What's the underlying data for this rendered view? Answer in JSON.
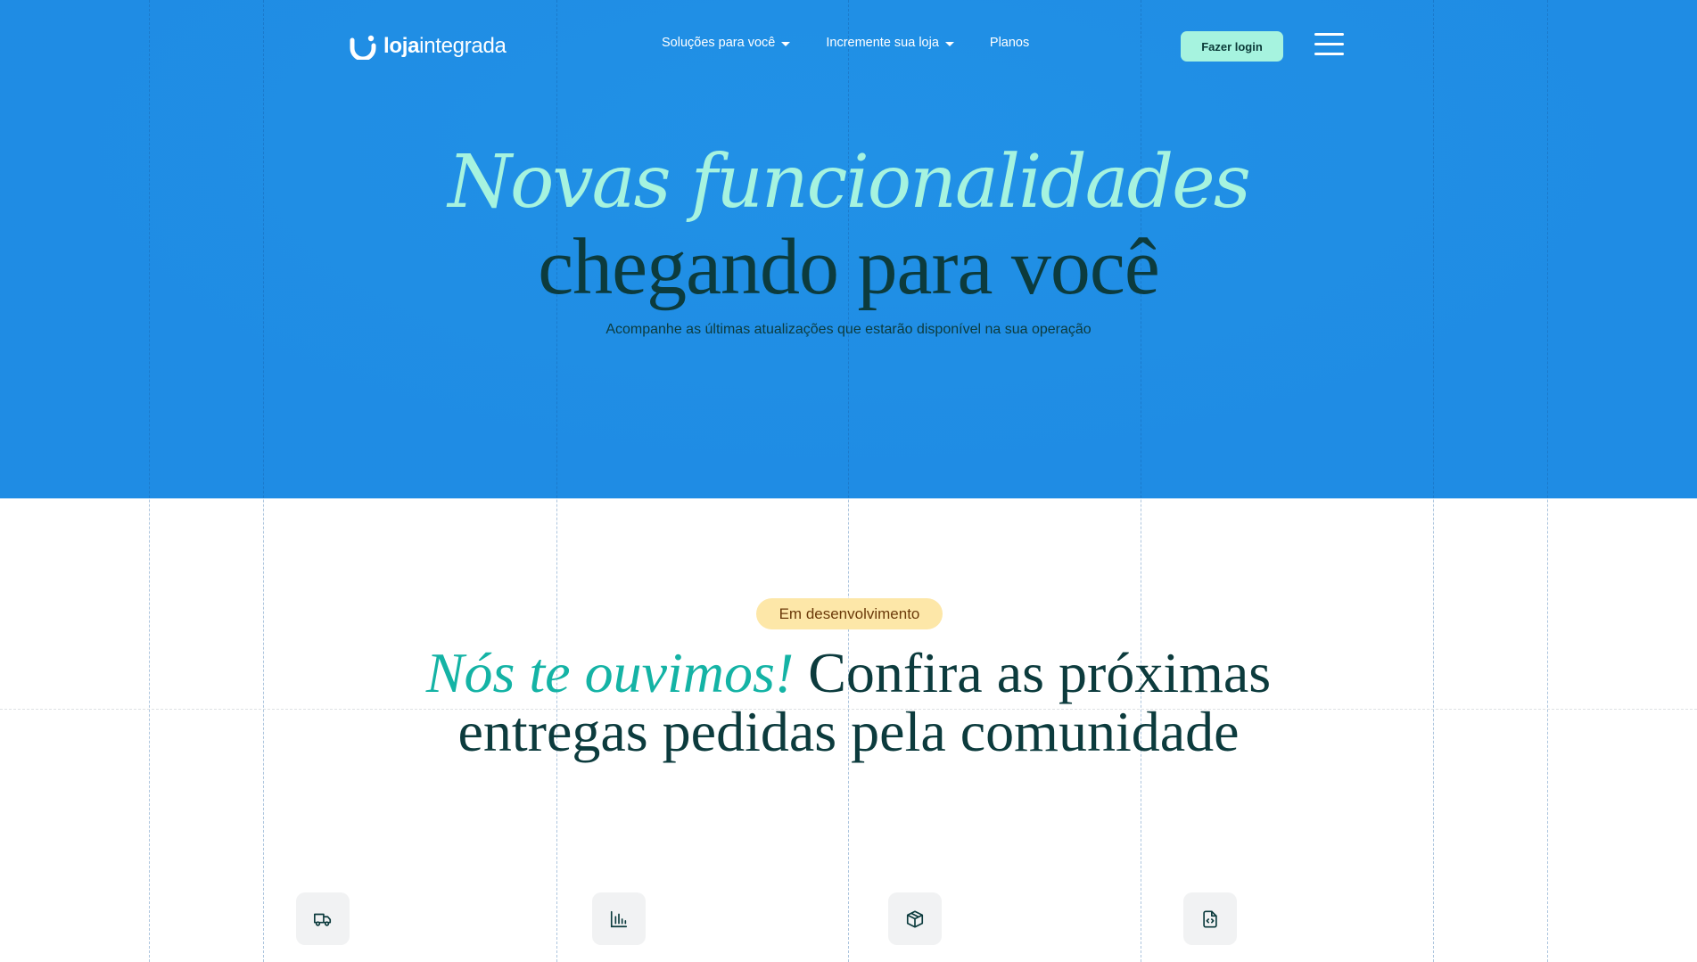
{
  "header": {
    "logo_bold": "loja",
    "logo_light": "integrada",
    "nav": [
      {
        "label": "Soluções para você",
        "has_dropdown": true
      },
      {
        "label": "Incremente sua loja",
        "has_dropdown": true
      },
      {
        "label": "Planos",
        "has_dropdown": false
      }
    ],
    "login_label": "Fazer login"
  },
  "hero": {
    "title_line1": "Novas funcionalidades",
    "title_line2": "chegando para você",
    "subtitle": "Acompanhe as últimas atualizações que estarão disponível na sua operação"
  },
  "roadmap": {
    "badge": "Em desenvolvimento",
    "title_accent": "Nós te ouvimos!",
    "title_rest_line1": " Confira as próximas",
    "title_line2": "entregas pedidas pela comunidade",
    "feature_icons": [
      "truck-icon",
      "bar-chart-icon",
      "package-icon",
      "code-file-icon"
    ]
  },
  "colors": {
    "hero_bg": "#2191e6",
    "accent_mint": "#a6f3df",
    "dark_teal": "#0c3b3d",
    "accent_teal": "#14b3a5",
    "badge_bg": "#fde7a8"
  }
}
